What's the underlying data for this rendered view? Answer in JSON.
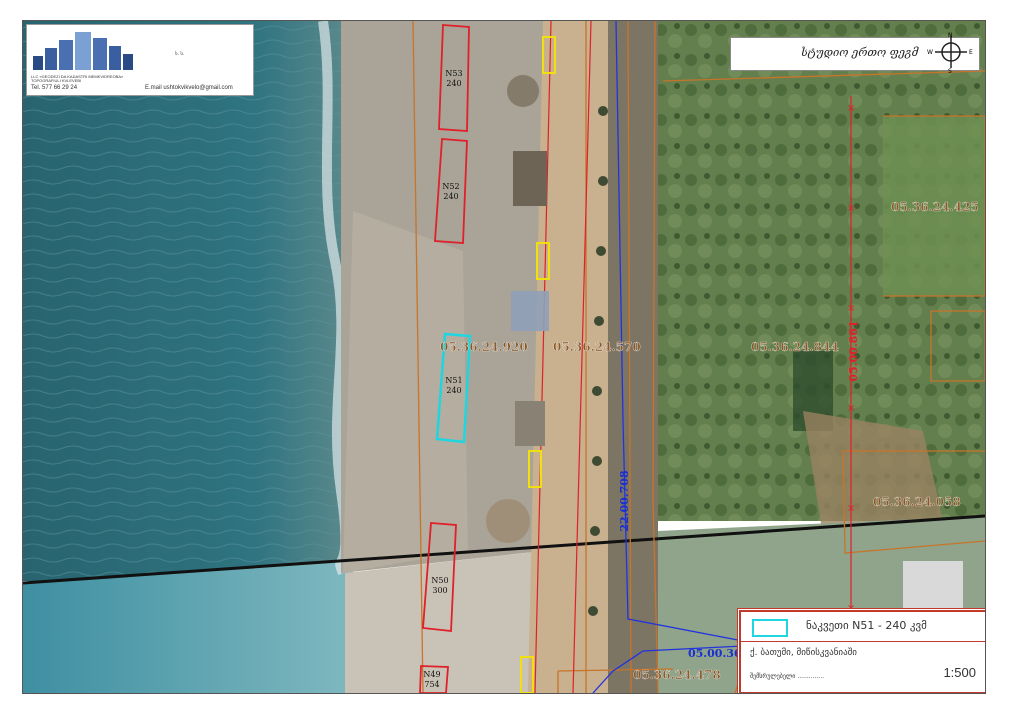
{
  "logo": {
    "line1": "LLC «GEODEZI DA KADASTRI MEMKVIDREOBA»",
    "line2": "TOPOGRAFIULI KVLEVEBI",
    "tel_label": "Tel.",
    "tel_value": "577 66 29 24",
    "email_label": "E.mail",
    "email_value": "ushtokvikvelo@gmail.com",
    "corner": "ს. ს."
  },
  "signature_label": "სტუდიო ერთო ფეგმ",
  "compass": {
    "n": "N",
    "s": "S",
    "e": "E",
    "w": "W"
  },
  "parcels": [
    {
      "label": "05.36.24.920"
    },
    {
      "label": "05.36.24.570"
    },
    {
      "label": "05.36.24.844"
    },
    {
      "label": "05.36.24.425"
    },
    {
      "label": "05.36.24.058"
    },
    {
      "label": "05.36.24.478"
    }
  ],
  "roads": [
    {
      "label": "05.00.861"
    },
    {
      "label": "22.00.708"
    },
    {
      "label": "05.00.36"
    }
  ],
  "plots": [
    {
      "label": "N53",
      "area": "240",
      "selected": false
    },
    {
      "label": "N52",
      "area": "240",
      "selected": false
    },
    {
      "label": "N51",
      "area": "240",
      "selected": true
    },
    {
      "label": "N50",
      "area": "300",
      "selected": false
    },
    {
      "label": "N49",
      "area": "754",
      "selected": false
    }
  ],
  "legend": {
    "item_label": "ნაკვეთი N51 - 240 კვმ",
    "city": "ქ. ბათუმი, მიწისკვანიაში",
    "note": "შემსრულებელი ..............",
    "scale": "1:500"
  },
  "colors": {
    "plot_outline": "#e0202a",
    "selected_plot": "#1fd6e0",
    "parcel_line": "#c8742a",
    "road_line": "#2233dd",
    "parcel_label": "#8a5a2b",
    "road_label_red": "#e0202a",
    "road_label_blue": "#1a2fd0",
    "facility": "#f0e010",
    "sea": "#2c6b78",
    "beach": "#a8a396",
    "vegetation": "#5f7d4a"
  }
}
